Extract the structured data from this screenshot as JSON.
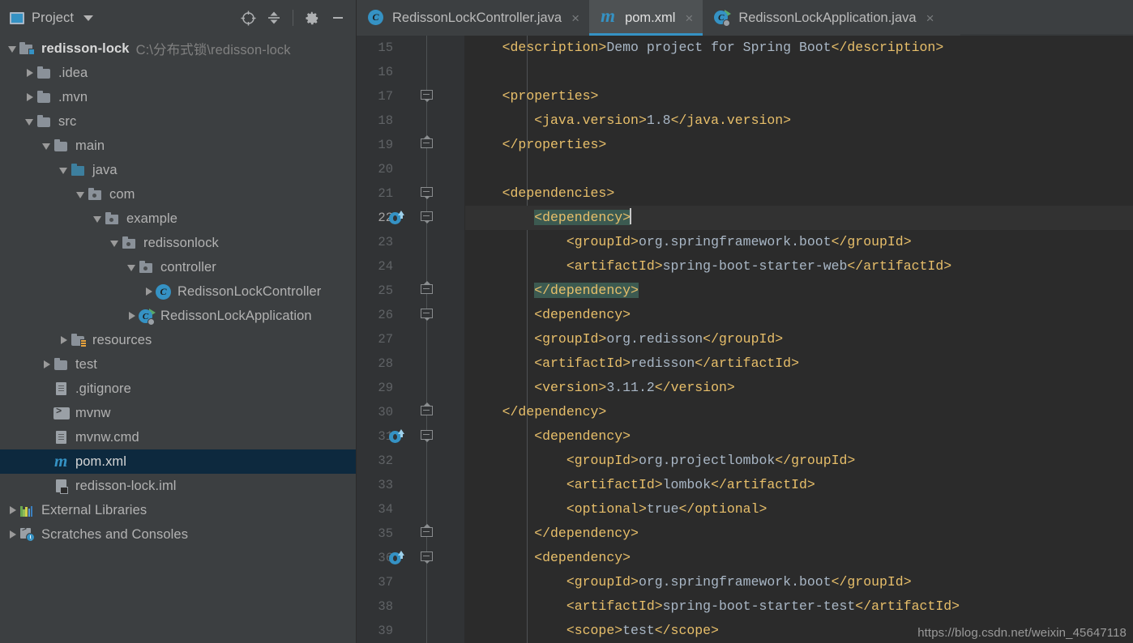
{
  "panel": {
    "title": "Project",
    "icons": {
      "project_icon": "project-window-icon",
      "locate": "target-locate-icon",
      "collapse_all": "collapse-all-icon",
      "settings": "gear-icon",
      "hide": "minimize-icon"
    }
  },
  "tree": [
    {
      "label": "redisson-lock",
      "path_suffix": "C:\\分布式锁\\redisson-lock",
      "icon": "module-folder-icon",
      "indent": 0,
      "state": "expanded",
      "bold": true,
      "name": "tree-item-redisson-lock"
    },
    {
      "label": ".idea",
      "icon": "folder-icon",
      "indent": 1,
      "state": "collapsed",
      "name": "tree-item-idea"
    },
    {
      "label": ".mvn",
      "icon": "folder-icon",
      "indent": 1,
      "state": "collapsed",
      "name": "tree-item-mvn"
    },
    {
      "label": "src",
      "icon": "folder-icon",
      "indent": 1,
      "state": "expanded",
      "name": "tree-item-src"
    },
    {
      "label": "main",
      "icon": "folder-icon",
      "indent": 2,
      "state": "expanded",
      "name": "tree-item-main"
    },
    {
      "label": "java",
      "icon": "source-root-folder-icon",
      "indent": 3,
      "state": "expanded",
      "name": "tree-item-java"
    },
    {
      "label": "com",
      "icon": "package-folder-icon",
      "indent": 4,
      "state": "expanded",
      "name": "tree-item-com"
    },
    {
      "label": "example",
      "icon": "package-folder-icon",
      "indent": 5,
      "state": "expanded",
      "name": "tree-item-example"
    },
    {
      "label": "redissonlock",
      "icon": "package-folder-icon",
      "indent": 6,
      "state": "expanded",
      "name": "tree-item-redissonlock"
    },
    {
      "label": "controller",
      "icon": "package-folder-icon",
      "indent": 7,
      "state": "expanded",
      "name": "tree-item-controller"
    },
    {
      "label": "RedissonLockController",
      "icon": "java-class-icon",
      "indent": 8,
      "state": "collapsed",
      "name": "tree-item-redissonlockcontroller"
    },
    {
      "label": "RedissonLockApplication",
      "icon": "spring-boot-class-icon",
      "indent": 7,
      "state": "collapsed",
      "name": "tree-item-redissonlockapplication"
    },
    {
      "label": "resources",
      "icon": "resources-folder-icon",
      "indent": 3,
      "state": "collapsed",
      "name": "tree-item-resources"
    },
    {
      "label": "test",
      "icon": "folder-icon",
      "indent": 2,
      "state": "collapsed",
      "name": "tree-item-test"
    },
    {
      "label": ".gitignore",
      "icon": "file-icon",
      "indent": 2,
      "state": "leaf",
      "name": "tree-item-gitignore"
    },
    {
      "label": "mvnw",
      "icon": "shell-script-icon",
      "indent": 2,
      "state": "leaf",
      "name": "tree-item-mvnw"
    },
    {
      "label": "mvnw.cmd",
      "icon": "file-icon",
      "indent": 2,
      "state": "leaf",
      "name": "tree-item-mvnw-cmd"
    },
    {
      "label": "pom.xml",
      "icon": "maven-icon",
      "indent": 2,
      "state": "leaf",
      "selected": true,
      "name": "tree-item-pom-xml"
    },
    {
      "label": "redisson-lock.iml",
      "icon": "iml-file-icon",
      "indent": 2,
      "state": "leaf",
      "name": "tree-item-redisson-lock-iml"
    },
    {
      "label": "External Libraries",
      "icon": "external-libraries-icon",
      "indent": 0,
      "state": "collapsed",
      "name": "tree-item-external-libraries"
    },
    {
      "label": "Scratches and Consoles",
      "icon": "scratches-icon",
      "indent": 0,
      "state": "collapsed",
      "name": "tree-item-scratches-and-consoles"
    }
  ],
  "tabs": [
    {
      "label": "RedissonLockController.java",
      "icon": "java-class-icon",
      "active": false,
      "close": "×",
      "name": "tab-redissonlockcontroller-java"
    },
    {
      "label": "pom.xml",
      "icon": "maven-icon",
      "active": true,
      "close": "×",
      "name": "tab-pom-xml"
    },
    {
      "label": "RedissonLockApplication.java",
      "icon": "spring-boot-class-icon",
      "active": false,
      "close": "×",
      "name": "tab-redissonlockapplication-java"
    }
  ],
  "editor": {
    "first_line": 15,
    "current_line": 22,
    "lines": [
      {
        "n": 15,
        "indent": 1,
        "segs": [
          {
            "t": "tag",
            "v": "<description>"
          },
          {
            "t": "txt",
            "v": "Demo project for Spring Boot"
          },
          {
            "t": "tag",
            "v": "</description>"
          }
        ]
      },
      {
        "n": 16,
        "indent": 0,
        "segs": []
      },
      {
        "n": 17,
        "indent": 1,
        "fold": "down",
        "segs": [
          {
            "t": "tag",
            "v": "<properties>"
          }
        ]
      },
      {
        "n": 18,
        "indent": 2,
        "segs": [
          {
            "t": "tag",
            "v": "<java.version>"
          },
          {
            "t": "txt",
            "v": "1.8"
          },
          {
            "t": "tag",
            "v": "</java.version>"
          }
        ]
      },
      {
        "n": 19,
        "indent": 1,
        "fold": "up",
        "segs": [
          {
            "t": "tag",
            "v": "</properties>"
          }
        ]
      },
      {
        "n": 20,
        "indent": 0,
        "segs": []
      },
      {
        "n": 21,
        "indent": 1,
        "fold": "down",
        "segs": [
          {
            "t": "tag",
            "v": "<dependencies>"
          }
        ]
      },
      {
        "n": 22,
        "indent": 2,
        "fold": "down",
        "gutter_icon": "maven-reimport-icon",
        "current": true,
        "segs": [
          {
            "t": "mark",
            "v": "<dependency>"
          },
          {
            "t": "caret",
            "v": ""
          }
        ]
      },
      {
        "n": 23,
        "indent": 3,
        "segs": [
          {
            "t": "tag",
            "v": "<groupId>"
          },
          {
            "t": "txt",
            "v": "org.springframework.boot"
          },
          {
            "t": "tag",
            "v": "</groupId>"
          }
        ]
      },
      {
        "n": 24,
        "indent": 3,
        "segs": [
          {
            "t": "tag",
            "v": "<artifactId>"
          },
          {
            "t": "txt",
            "v": "spring-boot-starter-web"
          },
          {
            "t": "tag",
            "v": "</artifactId>"
          }
        ]
      },
      {
        "n": 25,
        "indent": 2,
        "fold": "up",
        "segs": [
          {
            "t": "mark",
            "v": "</dependency>"
          }
        ]
      },
      {
        "n": 26,
        "indent": 2,
        "fold": "down",
        "segs": [
          {
            "t": "tag",
            "v": "<dependency>"
          }
        ]
      },
      {
        "n": 27,
        "indent": 2,
        "segs": [
          {
            "t": "tag",
            "v": "<groupId>"
          },
          {
            "t": "txt",
            "v": "org.redisson"
          },
          {
            "t": "tag",
            "v": "</groupId>"
          }
        ]
      },
      {
        "n": 28,
        "indent": 2,
        "segs": [
          {
            "t": "tag",
            "v": "<artifactId>"
          },
          {
            "t": "txt",
            "v": "redisson"
          },
          {
            "t": "tag",
            "v": "</artifactId>"
          }
        ]
      },
      {
        "n": 29,
        "indent": 2,
        "segs": [
          {
            "t": "tag",
            "v": "<version>"
          },
          {
            "t": "txt",
            "v": "3.11.2"
          },
          {
            "t": "tag",
            "v": "</version>"
          }
        ]
      },
      {
        "n": 30,
        "indent": 1,
        "fold": "up",
        "segs": [
          {
            "t": "tag",
            "v": "</dependency>"
          }
        ]
      },
      {
        "n": 31,
        "indent": 2,
        "fold": "down",
        "gutter_icon": "maven-reimport-icon",
        "segs": [
          {
            "t": "tag",
            "v": "<dependency>"
          }
        ]
      },
      {
        "n": 32,
        "indent": 3,
        "segs": [
          {
            "t": "tag",
            "v": "<groupId>"
          },
          {
            "t": "txt",
            "v": "org.projectlombok"
          },
          {
            "t": "tag",
            "v": "</groupId>"
          }
        ]
      },
      {
        "n": 33,
        "indent": 3,
        "segs": [
          {
            "t": "tag",
            "v": "<artifactId>"
          },
          {
            "t": "txt",
            "v": "lombok"
          },
          {
            "t": "tag",
            "v": "</artifactId>"
          }
        ]
      },
      {
        "n": 34,
        "indent": 3,
        "segs": [
          {
            "t": "tag",
            "v": "<optional>"
          },
          {
            "t": "txt",
            "v": "true"
          },
          {
            "t": "tag",
            "v": "</optional>"
          }
        ]
      },
      {
        "n": 35,
        "indent": 2,
        "fold": "up",
        "segs": [
          {
            "t": "tag",
            "v": "</dependency>"
          }
        ]
      },
      {
        "n": 36,
        "indent": 2,
        "fold": "down",
        "gutter_icon": "maven-reimport-icon",
        "segs": [
          {
            "t": "tag",
            "v": "<dependency>"
          }
        ]
      },
      {
        "n": 37,
        "indent": 3,
        "segs": [
          {
            "t": "tag",
            "v": "<groupId>"
          },
          {
            "t": "txt",
            "v": "org.springframework.boot"
          },
          {
            "t": "tag",
            "v": "</groupId>"
          }
        ]
      },
      {
        "n": 38,
        "indent": 3,
        "segs": [
          {
            "t": "tag",
            "v": "<artifactId>"
          },
          {
            "t": "txt",
            "v": "spring-boot-starter-test"
          },
          {
            "t": "tag",
            "v": "</artifactId>"
          }
        ]
      },
      {
        "n": 39,
        "indent": 3,
        "segs": [
          {
            "t": "tag",
            "v": "<scope>"
          },
          {
            "t": "txt",
            "v": "test"
          },
          {
            "t": "tag",
            "v": "</scope>"
          }
        ]
      }
    ]
  },
  "browsers": [
    {
      "name": "chrome-icon",
      "cls": "br-chrome"
    },
    {
      "name": "firefox-icon",
      "cls": "br-ff"
    },
    {
      "name": "safari-icon",
      "cls": "br-safari"
    },
    {
      "name": "opera-icon",
      "cls": "br-opera"
    },
    {
      "name": "internet-explorer-icon",
      "cls": "br-ie"
    },
    {
      "name": "edge-icon",
      "cls": "br-edge"
    }
  ],
  "annotation": {
    "arrow_color": "#f81e11",
    "name": "red-arrow-annotation"
  },
  "watermark": "https://blog.csdn.net/weixin_45647118",
  "colors": {
    "panel_bg": "#3c3f41",
    "editor_bg": "#2b2b2b",
    "gutter_bg": "#313335",
    "selection": "#0d293e",
    "accent": "#3592c4",
    "tag": "#e8bf6a",
    "text": "#a9b7c6",
    "match_highlight": "#3c5a51"
  }
}
